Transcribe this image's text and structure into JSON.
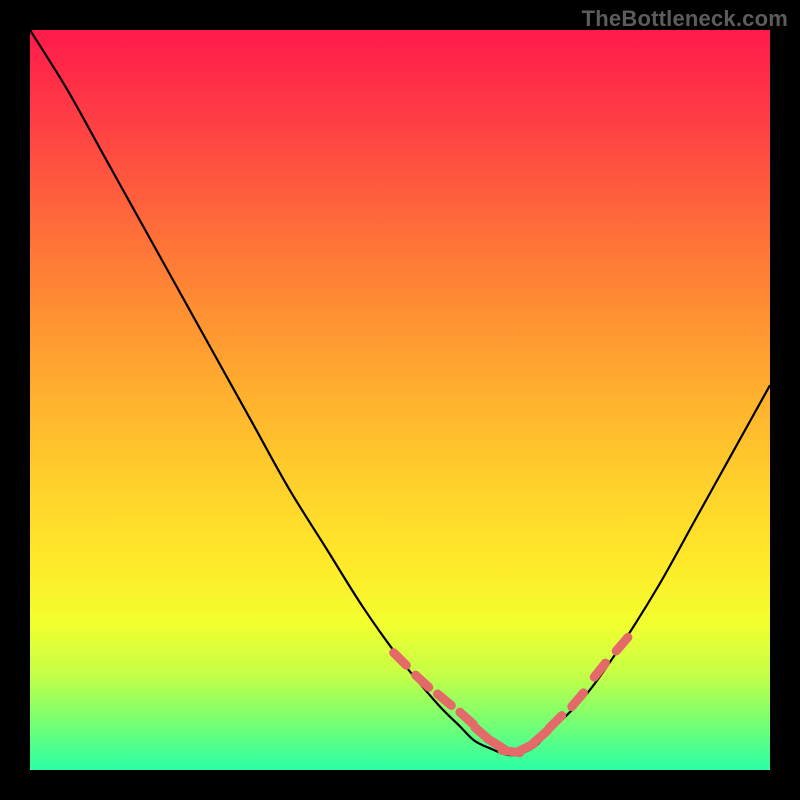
{
  "watermark": "TheBottleneck.com",
  "chart_data": {
    "type": "line",
    "title": "",
    "xlabel": "",
    "ylabel": "",
    "xlim": [
      0,
      100
    ],
    "ylim": [
      0,
      100
    ],
    "grid": false,
    "legend": false,
    "colors": {
      "top": "#ff1a4b",
      "mid": "#ffe92a",
      "bottom": "#2bffa6",
      "curve": "#000000",
      "markers": "#e46a6a"
    },
    "series": [
      {
        "name": "bottleneck-curve",
        "x": [
          0,
          5,
          10,
          15,
          20,
          25,
          30,
          35,
          40,
          45,
          50,
          55,
          58,
          60,
          62,
          65,
          68,
          70,
          75,
          80,
          85,
          90,
          95,
          100
        ],
        "values": [
          100,
          92,
          83,
          74,
          65,
          56,
          47,
          38,
          30,
          22,
          15,
          9,
          6,
          4,
          3,
          2,
          3,
          5,
          10,
          17,
          25,
          34,
          43,
          52
        ]
      }
    ],
    "markers": {
      "name": "highlight-points",
      "x": [
        50,
        53,
        56,
        59,
        61,
        63,
        65,
        67,
        69,
        71,
        74,
        77,
        80
      ],
      "values": [
        15,
        12,
        9.5,
        7,
        5,
        3.5,
        2.5,
        3,
        4.5,
        6.5,
        9.5,
        13.5,
        17
      ]
    },
    "background_type": "vertical-gradient-heatmap"
  }
}
